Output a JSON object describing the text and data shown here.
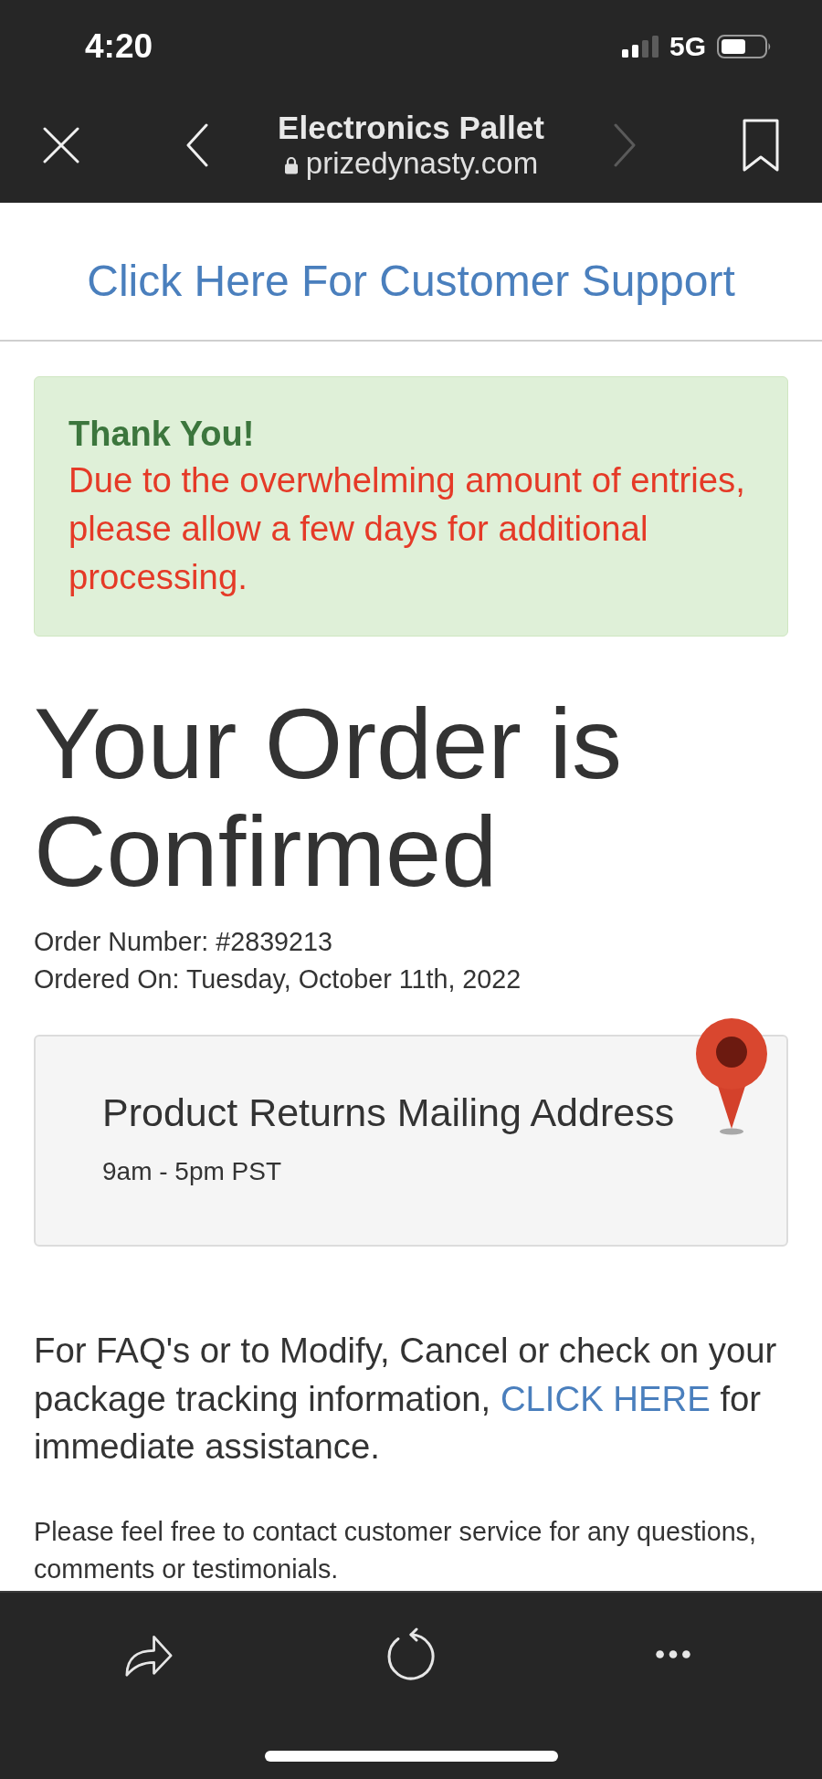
{
  "status_bar": {
    "time": "4:20",
    "network": "5G"
  },
  "browser_bar": {
    "title": "Electronics Pallet",
    "url": "prizedynasty.com",
    "back": {
      "disabled": false
    },
    "forward": {
      "disabled": true
    }
  },
  "support_link": "Click Here For Customer Support",
  "alert": {
    "title": "Thank You!",
    "message": "Due to the overwhelming amount of entries, please allow a few days for additional processing."
  },
  "heading": "Your Order is Confirmed",
  "order_details": [
    "Order Number: #2839213",
    "Ordered On: Tuesday, October 11th, 2022"
  ],
  "address_card": {
    "title": "Product Returns Mailing Address",
    "hours": "9am - 5pm PST"
  },
  "faq_text": {
    "before": "For FAQ's or to Modify, Cancel or check on your package tracking information,",
    "link": "CLICK HERE",
    "after": "for immediate assistance."
  },
  "contact_note": "Please feel free to contact customer service for any questions, comments or testimonials."
}
